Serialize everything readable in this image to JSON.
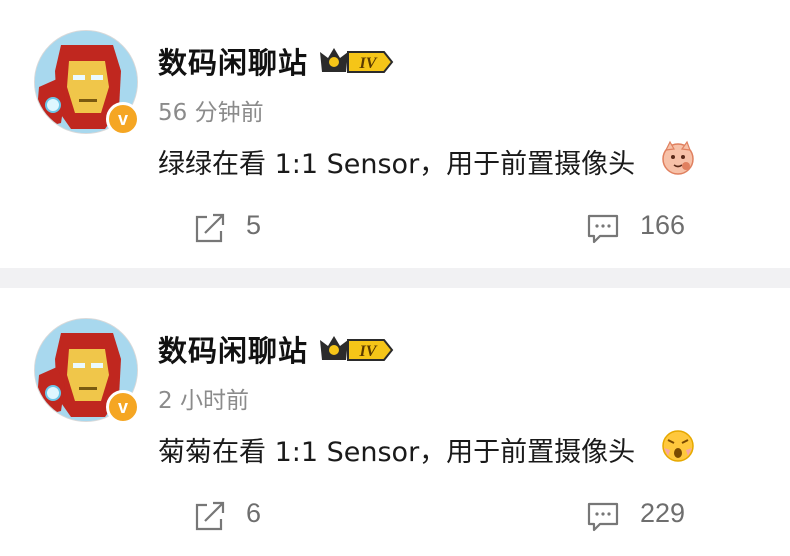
{
  "posts": [
    {
      "username": "数码闲聊站",
      "level_badge": "IV",
      "time": "56 分钟前",
      "content": "绿绿在看 1:1 Sensor，用于前置摄像头",
      "emoji_icon": "cat-thinking-emoji",
      "repost_count": "5",
      "comment_count": "166"
    },
    {
      "username": "数码闲聊站",
      "level_badge": "IV",
      "time": "2 小时前",
      "content": "菊菊在看 1:1 Sensor，用于前置摄像头",
      "emoji_icon": "surprised-face-emoji",
      "repost_count": "6",
      "comment_count": "229"
    }
  ],
  "verified_mark": "v",
  "colors": {
    "badge_gold": "#f5a623",
    "divider": "#f1f1f3",
    "text_gray": "#8b8b8b"
  }
}
